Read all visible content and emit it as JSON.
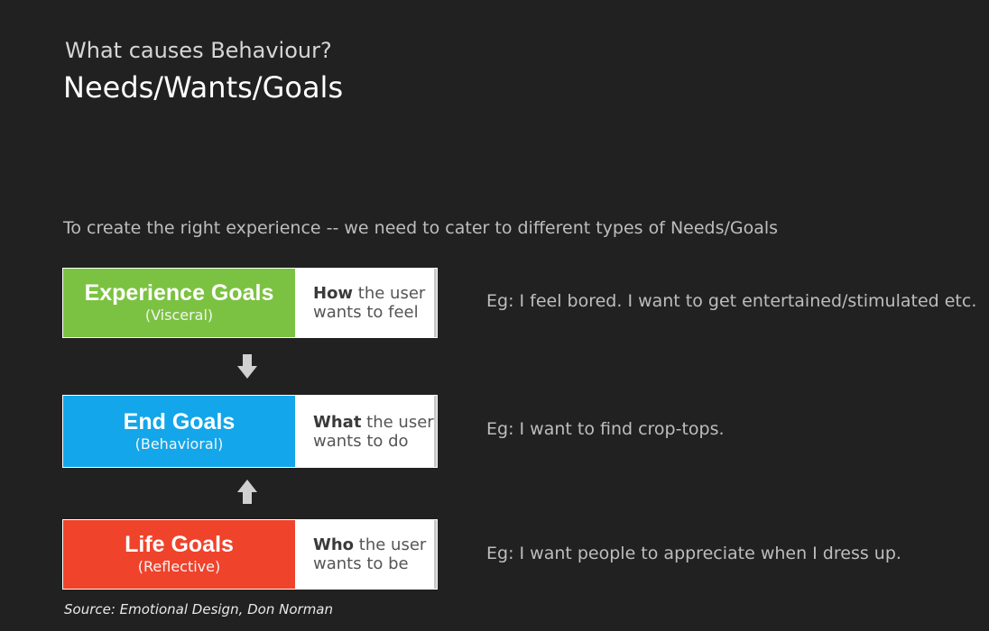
{
  "header": {
    "subtitle": "What causes Behaviour?",
    "title": "Needs/Wants/Goals"
  },
  "intro": "To create the right experience -- we need to cater to different types of Needs/Goals",
  "goals": [
    {
      "name": "Experience Goals",
      "level": "(Visceral)",
      "question_word": "How",
      "desc_rest": " the user",
      "desc_line2": "wants to feel",
      "color": "#7cc242",
      "example": "Eg: I feel bored. I want to get entertained/stimulated etc."
    },
    {
      "name": "End Goals",
      "level": "(Behavioral)",
      "question_word": "What",
      "desc_rest": " the user",
      "desc_line2": "wants to do",
      "color": "#13a6ea",
      "example": "Eg: I want to find crop-tops."
    },
    {
      "name": "Life Goals",
      "level": "(Reflective)",
      "question_word": "Who",
      "desc_rest": " the user",
      "desc_line2": "wants to be",
      "color": "#ef432c",
      "example": "Eg: I want people to appreciate when I dress up."
    }
  ],
  "arrows": [
    {
      "direction": "down",
      "icon": "arrow-down-icon"
    },
    {
      "direction": "up",
      "icon": "arrow-up-icon"
    }
  ],
  "source": "Source: Emotional Design, Don Norman"
}
